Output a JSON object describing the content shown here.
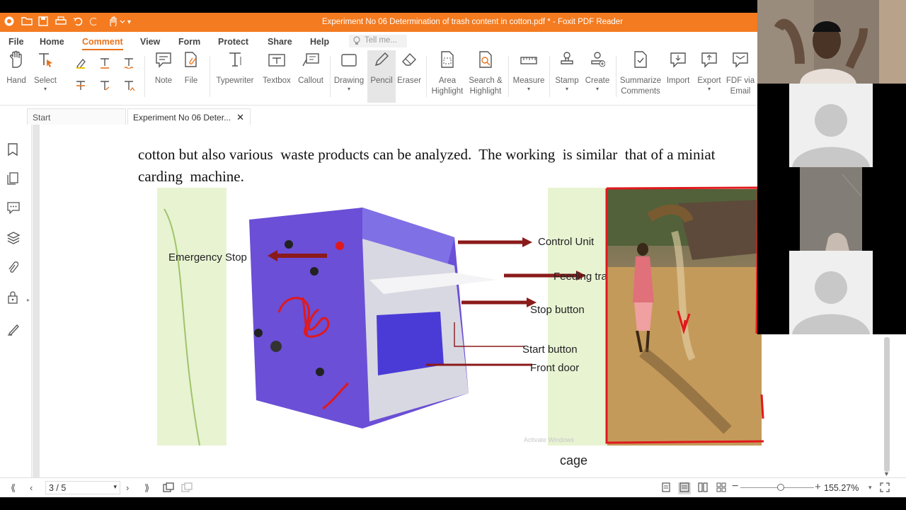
{
  "window": {
    "title": "Experiment No 06 Determination of trash content in cotton.pdf * - Foxit PDF Reader"
  },
  "menu": {
    "items": [
      "File",
      "Home",
      "Comment",
      "View",
      "Form",
      "Protect",
      "Share",
      "Help"
    ],
    "active": "Comment",
    "tell_me_placeholder": "Tell me..."
  },
  "ribbon": {
    "tools": [
      {
        "label": "Hand",
        "icon": "hand-icon"
      },
      {
        "label": "Select",
        "icon": "select-text-icon"
      },
      {
        "label": "Note",
        "icon": "note-icon"
      },
      {
        "label": "File",
        "icon": "file-attach-icon"
      },
      {
        "label": "Typewriter",
        "icon": "typewriter-icon"
      },
      {
        "label": "Textbox",
        "icon": "textbox-icon"
      },
      {
        "label": "Callout",
        "icon": "callout-icon"
      },
      {
        "label": "Drawing",
        "icon": "drawing-icon"
      },
      {
        "label": "Pencil",
        "icon": "pencil-icon"
      },
      {
        "label": "Eraser",
        "icon": "eraser-icon"
      },
      {
        "label": "Area\nHighlight",
        "icon": "area-highlight-icon"
      },
      {
        "label": "Search &\nHighlight",
        "icon": "search-highlight-icon"
      },
      {
        "label": "Measure",
        "icon": "measure-icon"
      },
      {
        "label": "Stamp",
        "icon": "stamp-icon"
      },
      {
        "label": "Create",
        "icon": "create-icon"
      },
      {
        "label": "Summarize\nComments",
        "icon": "summarize-icon"
      },
      {
        "label": "Import",
        "icon": "import-icon"
      },
      {
        "label": "Export",
        "icon": "export-icon"
      },
      {
        "label": "FDF via\nEmail",
        "icon": "fdf-email-icon"
      }
    ],
    "selected": "Pencil"
  },
  "tabs": [
    {
      "label": "Start"
    },
    {
      "label": "Experiment No 06 Deter..."
    }
  ],
  "document": {
    "line1": "cotton but also various  waste products can be analyzed.  The working  is similar  that of a miniat",
    "line2": "carding  machine.",
    "diagram_labels": {
      "emergency_stop": "Emergency Stop",
      "control_unit": "Control Unit",
      "feeding_tray": "Feeding tray",
      "stop_button": "Stop button",
      "start_button": "Start button",
      "front_door": "Front door"
    },
    "watermark": "Activate Windows",
    "caption": "cage"
  },
  "status": {
    "page": "3 / 5",
    "zoom": "155.27%",
    "zoom_level_fraction": 0.55
  },
  "colors": {
    "accent": "#f47b20",
    "ink": "#e0191c"
  }
}
